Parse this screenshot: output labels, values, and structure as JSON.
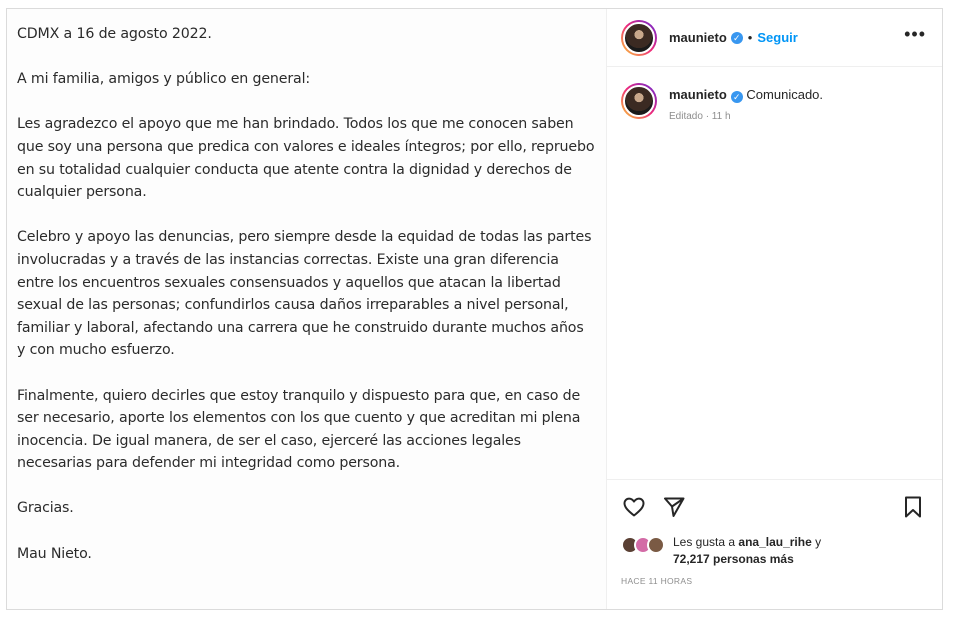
{
  "letter": {
    "date_line": "CDMX a 16 de agosto 2022.",
    "salutation": "A mi familia, amigos y público en general:",
    "paragraph_1": "Les  agradezco el apoyo que me han brindado. Todos los que me conocen saben que soy una persona que predica con valores e ideales íntegros; por ello, repruebo en su totalidad cualquier conducta que atente contra la dignidad y derechos de cualquier persona.",
    "paragraph_2": "Celebro y apoyo las denuncias, pero siempre desde la equidad de todas las partes involucradas y a través de las instancias correctas. Existe una gran diferencia entre los encuentros sexuales consensuados y aquellos que atacan la libertad sexual de las personas; confundirlos causa daños irreparables a nivel personal, familiar y laboral, afectando una carrera que he construido durante muchos años y con mucho esfuerzo.",
    "paragraph_3": "Finalmente, quiero decirles que estoy tranquilo y dispuesto para que, en caso de ser necesario, aporte los elementos con los que cuento y que acreditan mi plena inocencia. De igual manera, de ser el caso, ejerceré las acciones legales necesarias para defender mi integridad como persona.",
    "closing": "Gracias.",
    "signature": "Mau Nieto."
  },
  "header": {
    "username": "maunieto",
    "separator": "•",
    "follow_label": "Seguir",
    "more_label": "•••"
  },
  "caption": {
    "username": "maunieto",
    "text": "Comunicado.",
    "meta": "Editado · 11 h"
  },
  "likes": {
    "prefix": "Les gusta a",
    "liker": "ana_lau_rihe",
    "conjunction": "y",
    "count_text": "72,217 personas más"
  },
  "timestamp": "HACE 11 HORAS",
  "icons": {
    "verified": "verified-badge-icon",
    "like": "heart-icon",
    "share": "paper-plane-icon",
    "save": "bookmark-icon"
  },
  "colors": {
    "accent": "#0095f6",
    "verified": "#3897f0",
    "muted": "#8e8e8e"
  }
}
